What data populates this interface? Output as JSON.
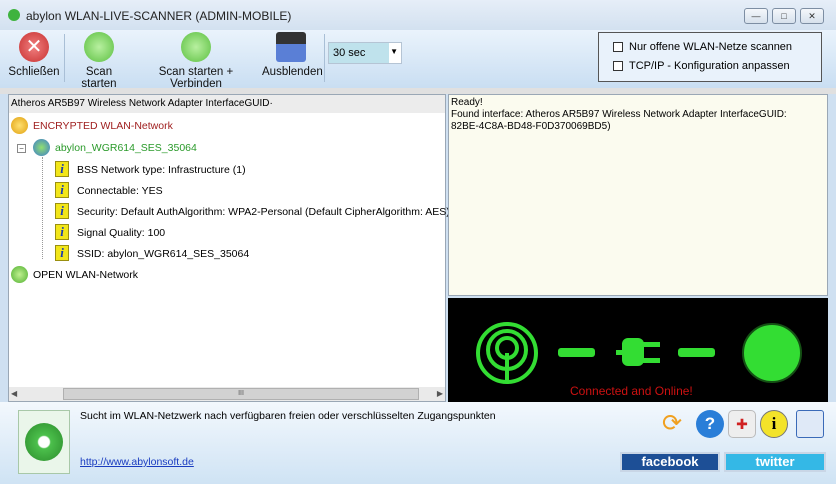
{
  "window": {
    "title": "abylon WLAN-LIVE-SCANNER (ADMIN-MOBILE)",
    "min": "—",
    "max": "□",
    "close": "✕"
  },
  "toolbar": {
    "close": "Schließen",
    "scan": "Scan starten",
    "scan_connect": "Scan starten + Verbinden",
    "hide": "Ausblenden",
    "interval": "30 sec"
  },
  "options": {
    "only_open": "Nur offene WLAN-Netze scannen",
    "tcpip": "TCP/IP - Konfiguration anpassen"
  },
  "tree": {
    "header": "Atheros AR5B97 Wireless Network Adapter InterfaceGUID·",
    "encrypted": "ENCRYPTED WLAN-Network",
    "network": "abylon_WGR614_SES_35064",
    "details": [
      "BSS Network type: Infrastructure (1)",
      "Connectable: YES",
      "Security: Default AuthAlgorithm: WPA2-Personal (Default CipherAlgorithm: AES)",
      "Signal Quality: 100",
      "SSID: abylon_WGR614_SES_35064"
    ],
    "open": "OPEN WLAN-Network",
    "scroll_grip": "III"
  },
  "log": {
    "lines": [
      "Ready!",
      "Found interface: Atheros AR5B97 Wireless Network Adapter InterfaceGUID:",
      "82BE-4C8A-BD48-F0D370069BD5)"
    ]
  },
  "status": {
    "text": "Connected and Online!",
    "color": "#cc1111",
    "accent": "#33dd33"
  },
  "footer": {
    "description": "Sucht im WLAN-Netzwerk nach verfügbaren freien oder verschlüsselten Zugangspunkten",
    "link": "http://www.abylonsoft.de",
    "facebook": "facebook",
    "twitter": "twitter"
  }
}
